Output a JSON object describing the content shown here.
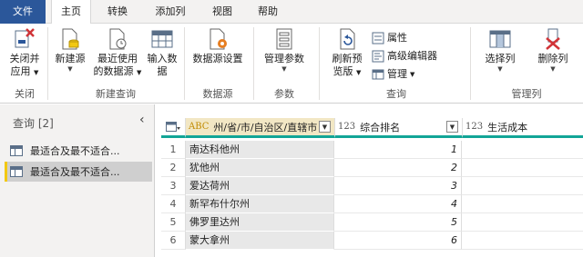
{
  "tabs": [
    {
      "label": "文件"
    },
    {
      "label": "主页"
    },
    {
      "label": "转换"
    },
    {
      "label": "添加列"
    },
    {
      "label": "视图"
    },
    {
      "label": "帮助"
    }
  ],
  "ribbon": {
    "close_apply": {
      "line1": "关闭并",
      "line2": "应用"
    },
    "new_source": {
      "line1": "新建源"
    },
    "recent_sources": {
      "line1": "最近使用",
      "line2": "的数据源"
    },
    "enter_data": {
      "line1": "输入数",
      "line2": "据"
    },
    "data_source_settings": {
      "line1": "数据源设置"
    },
    "manage_parameters": {
      "line1": "管理参数"
    },
    "refresh_preview": {
      "line1": "刷新预",
      "line2": "览版"
    },
    "properties": "属性",
    "advanced_editor": "高级编辑器",
    "manage": "管理",
    "choose_columns": {
      "line1": "选择列"
    },
    "remove_columns": {
      "line1": "删除列"
    },
    "groups": {
      "close": "关闭",
      "new_query": "新建查询",
      "data_sources": "数据源",
      "parameters": "参数",
      "query": "查询",
      "manage_columns": "管理列"
    }
  },
  "queries_pane": {
    "title": "查询 [2]",
    "items": [
      {
        "label": "最适合及最不适合..."
      },
      {
        "label": "最适合及最不适合..."
      }
    ]
  },
  "grid": {
    "columns": [
      {
        "name": "州/省/市/自治区/直辖市",
        "type": "ABC"
      },
      {
        "name": "综合排名",
        "type": "123"
      },
      {
        "name": "生活成本",
        "type": "123"
      }
    ],
    "rows": [
      {
        "n": "1",
        "state": "南达科他州",
        "rank": "1"
      },
      {
        "n": "2",
        "state": "犹他州",
        "rank": "2"
      },
      {
        "n": "3",
        "state": "爱达荷州",
        "rank": "3"
      },
      {
        "n": "4",
        "state": "新罕布什尔州",
        "rank": "4"
      },
      {
        "n": "5",
        "state": "佛罗里达州",
        "rank": "5"
      },
      {
        "n": "6",
        "state": "蒙大拿州",
        "rank": "6"
      }
    ]
  },
  "colors": {
    "accent": "#2b579a",
    "header_underline": "#12a597",
    "selection": "#f2c811"
  }
}
